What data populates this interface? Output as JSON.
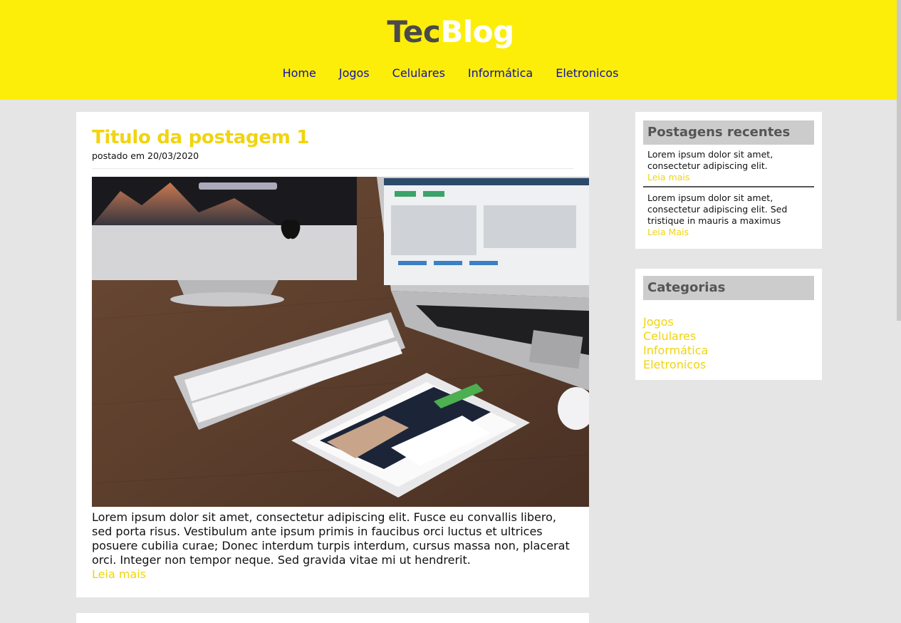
{
  "header": {
    "logo_part1": "Tec",
    "logo_part2": "Blog",
    "nav": [
      "Home",
      "Jogos",
      "Celulares",
      "Informática",
      "Eletronicos"
    ]
  },
  "post": {
    "title": "Titulo da postagem 1",
    "date": "postado em 20/03/2020",
    "image_description": "desk-devices-photo",
    "body": "Lorem ipsum dolor sit amet, consectetur adipiscing elit. Fusce eu convallis libero, sed porta risus. Vestibulum ante ipsum primis in faucibus orci luctus et ultrices posuere cubilia curae; Donec interdum turpis interdum, cursus massa non, placerat orci. Integer non tempor neque. Sed gravida vitae mi ut hendrerit.",
    "read_more": "Leia mais"
  },
  "sidebar": {
    "recent_title": "Postagens recentes",
    "recent": [
      {
        "text": "Lorem ipsum dolor sit amet, consectetur adipiscing elit.",
        "link": "Leia mais"
      },
      {
        "text": "Lorem ipsum dolor sit amet, consectetur adipiscing elit. Sed tristique in mauris a maximus",
        "link": "Leia Mais"
      }
    ],
    "categories_title": "Categorias",
    "categories": [
      "Jogos",
      "Celulares",
      "Informática",
      "Eletronicos"
    ]
  },
  "colors": {
    "header_bg": "#fcee09",
    "accent_yellow": "#f1d410",
    "nav_link": "#1010b0",
    "page_bg": "#e5e5e5"
  }
}
